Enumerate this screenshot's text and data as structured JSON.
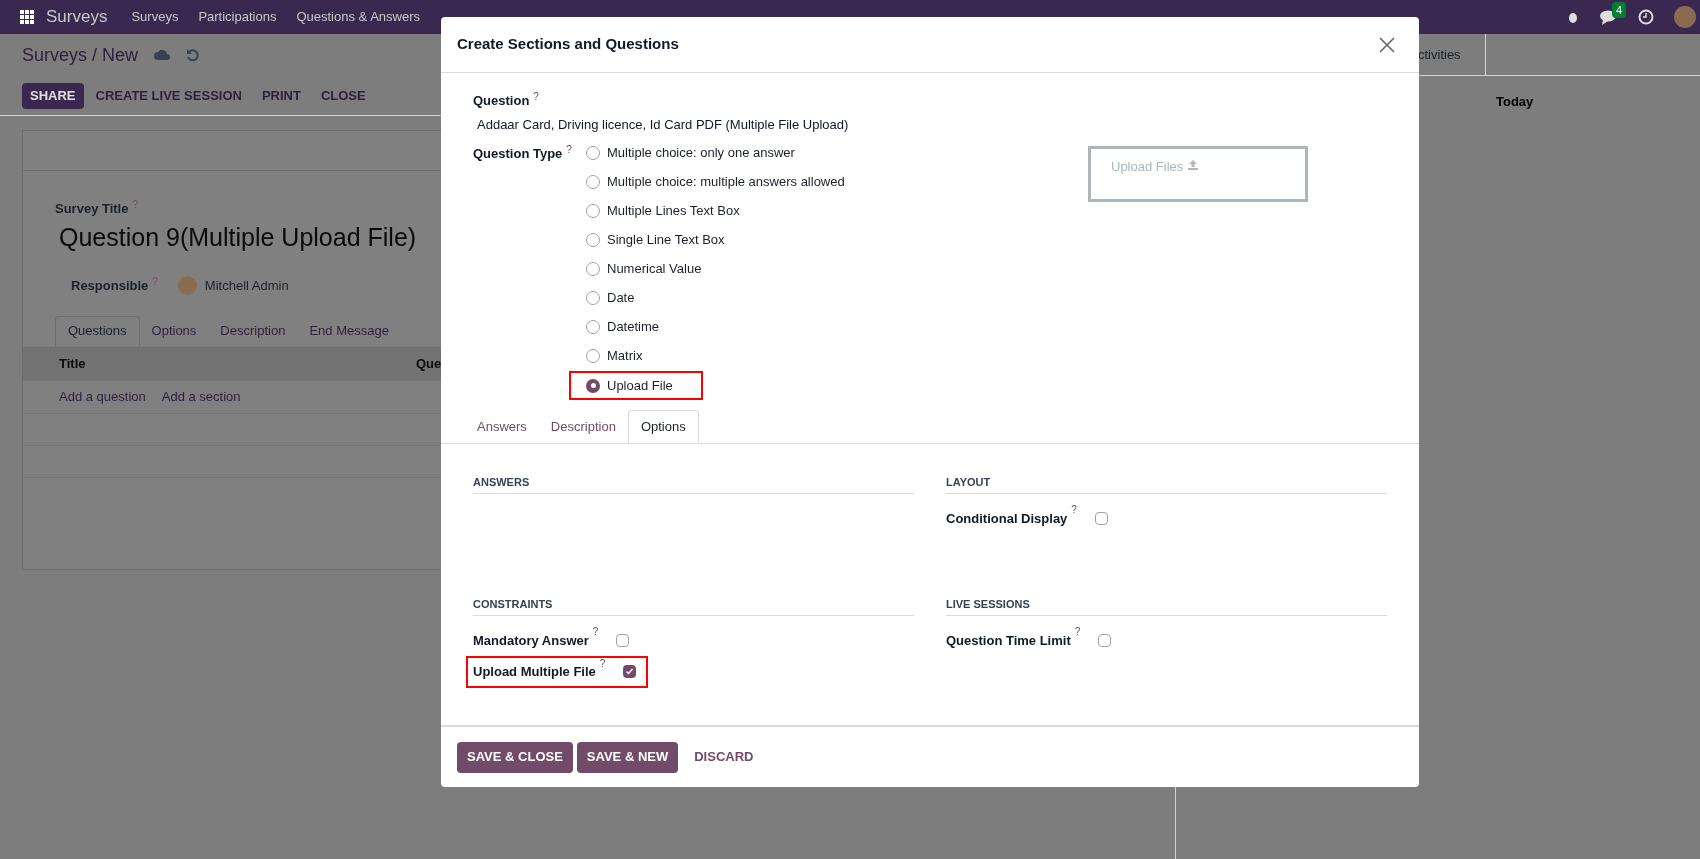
{
  "navbar": {
    "app": "Surveys",
    "menu": [
      "Surveys",
      "Participations",
      "Questions & Answers"
    ],
    "messages_badge": "4"
  },
  "breadcrumb": "Surveys / New",
  "actions": [
    {
      "label": "SHARE",
      "kind": "primary"
    },
    {
      "label": "CREATE LIVE SESSION",
      "kind": "plain"
    },
    {
      "label": "PRINT",
      "kind": "plain"
    },
    {
      "label": "CLOSE",
      "kind": "plain"
    }
  ],
  "form": {
    "title_label": "Survey Title",
    "title_help": "?",
    "title": "Question 9(Multiple Upload File)",
    "responsible_label": "Responsible",
    "responsible_help": "?",
    "responsible": "Mitchell Admin",
    "tabs": [
      {
        "label": "Questions",
        "selected": true
      },
      {
        "label": "Options",
        "selected": false
      },
      {
        "label": "Description",
        "selected": false
      },
      {
        "label": "End Message",
        "selected": false
      }
    ],
    "columns": [
      "Title",
      "Que"
    ],
    "add_links": [
      "Add a question",
      "Add a section"
    ]
  },
  "chatter": {
    "tab": "ctivities",
    "day": "Today"
  },
  "dialog": {
    "title": "Create Sections and Questions",
    "question_label": "Question",
    "question_help": "?",
    "question": "Addaar Card, Driving licence, Id Card PDF (Multiple File Upload)",
    "type_label": "Question Type",
    "type_help": "?",
    "types": [
      {
        "label": "Multiple choice: only one answer",
        "selected": false,
        "highlighted": false
      },
      {
        "label": "Multiple choice: multiple answers allowed",
        "selected": false,
        "highlighted": false
      },
      {
        "label": "Multiple Lines Text Box",
        "selected": false,
        "highlighted": false
      },
      {
        "label": "Single Line Text Box",
        "selected": false,
        "highlighted": false
      },
      {
        "label": "Numerical Value",
        "selected": false,
        "highlighted": false
      },
      {
        "label": "Date",
        "selected": false,
        "highlighted": false
      },
      {
        "label": "Datetime",
        "selected": false,
        "highlighted": false
      },
      {
        "label": "Matrix",
        "selected": false,
        "highlighted": false
      },
      {
        "label": "Upload File",
        "selected": true,
        "highlighted": true
      }
    ],
    "preview": "Upload Files",
    "tabs": [
      {
        "label": "Answers",
        "selected": false
      },
      {
        "label": "Description",
        "selected": false
      },
      {
        "label": "Options",
        "selected": true
      }
    ],
    "sections": [
      {
        "title": "ANSWERS"
      },
      {
        "title": "LAYOUT",
        "fields": [
          {
            "label": "Conditional Display",
            "help": "?",
            "checked": false,
            "highlighted": false
          }
        ]
      },
      {
        "title": "CONSTRAINTS",
        "fields": [
          {
            "label": "Mandatory Answer",
            "help": "?",
            "checked": false,
            "highlighted": false
          },
          {
            "label": "Upload Multiple File",
            "help": "?",
            "checked": true,
            "highlighted": true
          }
        ]
      },
      {
        "title": "LIVE SESSIONS",
        "fields": [
          {
            "label": "Question Time Limit",
            "help": "?",
            "checked": false,
            "highlighted": false
          }
        ]
      }
    ],
    "buttons": [
      {
        "label": "SAVE & CLOSE",
        "kind": "primary"
      },
      {
        "label": "SAVE & NEW",
        "kind": "primary"
      },
      {
        "label": "DISCARD",
        "kind": "link"
      }
    ]
  }
}
